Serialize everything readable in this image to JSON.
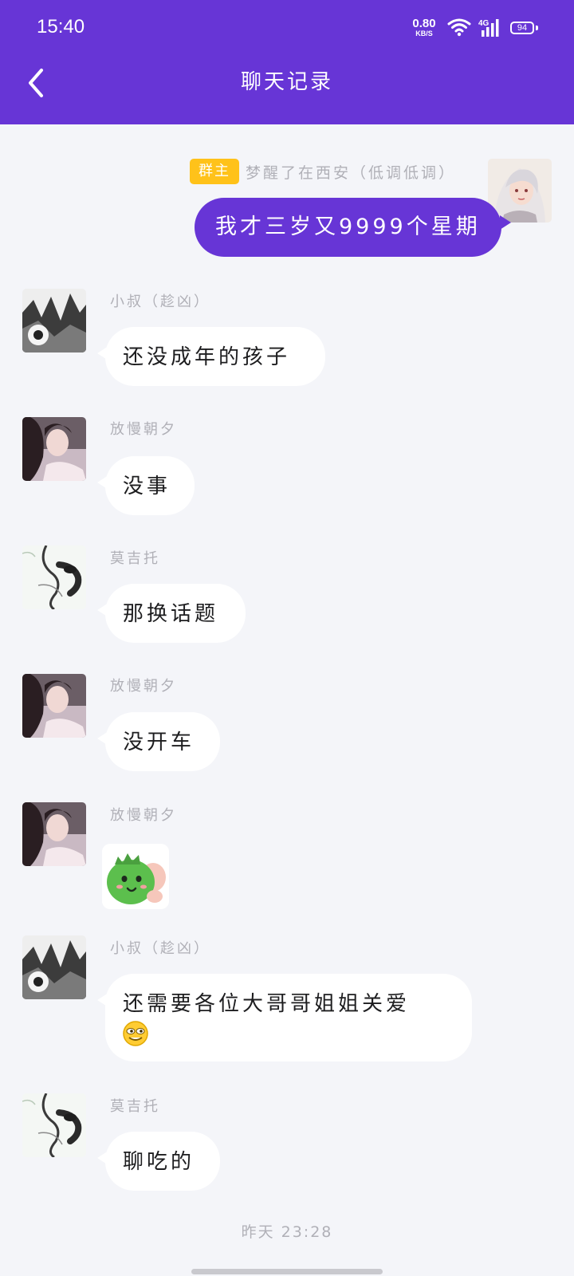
{
  "status_bar": {
    "time": "15:40",
    "net_speed_value": "0.80",
    "net_speed_unit": "KB/S",
    "network_type": "4G",
    "battery": "94"
  },
  "header": {
    "title": "聊天记录"
  },
  "theme": {
    "accent": "#6735d6",
    "badge": "#ffc21a",
    "background": "#f4f5f9"
  },
  "messages": [
    {
      "sender": "梦醒了在西安（低调低调）",
      "role_badge": "群主",
      "text": "我才三岁又9999个星期",
      "mine": true
    },
    {
      "sender": "小叔（趁凶）",
      "text": "还没成年的孩子"
    },
    {
      "sender": "放慢朝夕",
      "text": "没事"
    },
    {
      "sender": "莫吉托",
      "text": "那换话题"
    },
    {
      "sender": "放慢朝夕",
      "text": "没开车"
    },
    {
      "sender": "放慢朝夕",
      "sticker": "green-dinosaur-sticker"
    },
    {
      "sender": "小叔（趁凶）",
      "text": "还需要各位大哥哥姐姐关爱",
      "emoji": "grinning-face-emoji"
    },
    {
      "sender": "莫吉托",
      "text": "聊吃的"
    }
  ],
  "timestamp": "昨天 23:28"
}
